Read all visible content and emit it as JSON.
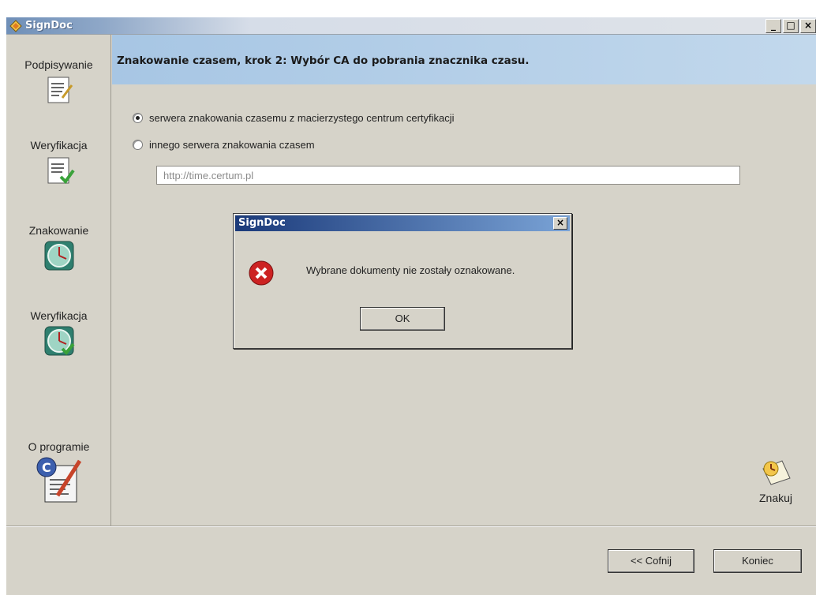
{
  "window": {
    "title": "SignDoc",
    "minimize": "_",
    "maximize": "□",
    "close": "×"
  },
  "sidebar": {
    "items": [
      {
        "label": "Podpisywanie",
        "icon": "document-sign-icon"
      },
      {
        "label": "Weryfikacja",
        "icon": "document-verify-icon"
      },
      {
        "label": "Znakowanie",
        "icon": "clock-icon"
      },
      {
        "label": "Weryfikacja",
        "icon": "clock-verify-icon"
      },
      {
        "label": "O programie",
        "icon": "about-certificate-icon"
      }
    ]
  },
  "main": {
    "heading": "Znakowanie czasem, krok 2: Wybór CA do pobrania znacznika czasu.",
    "options": [
      {
        "label": "serwera znakowania czasemu z macierzystego centrum certyfikacji",
        "checked": true
      },
      {
        "label": "innego serwera znakowania czasem",
        "checked": false
      }
    ],
    "url_value": "http://time.certum.pl",
    "action_label": "Znakuj"
  },
  "footer": {
    "back_label": "<< Cofnij",
    "finish_label": "Koniec"
  },
  "dialog": {
    "title": "SignDoc",
    "close": "×",
    "message": "Wybrane dokumenty nie zostały oznakowane.",
    "ok_label": "OK"
  },
  "colors": {
    "window_bg": "#d6d3c9",
    "header_band": "#a7c6e4",
    "dialog_title": "#1b3a7a",
    "error_red": "#cc2222"
  }
}
